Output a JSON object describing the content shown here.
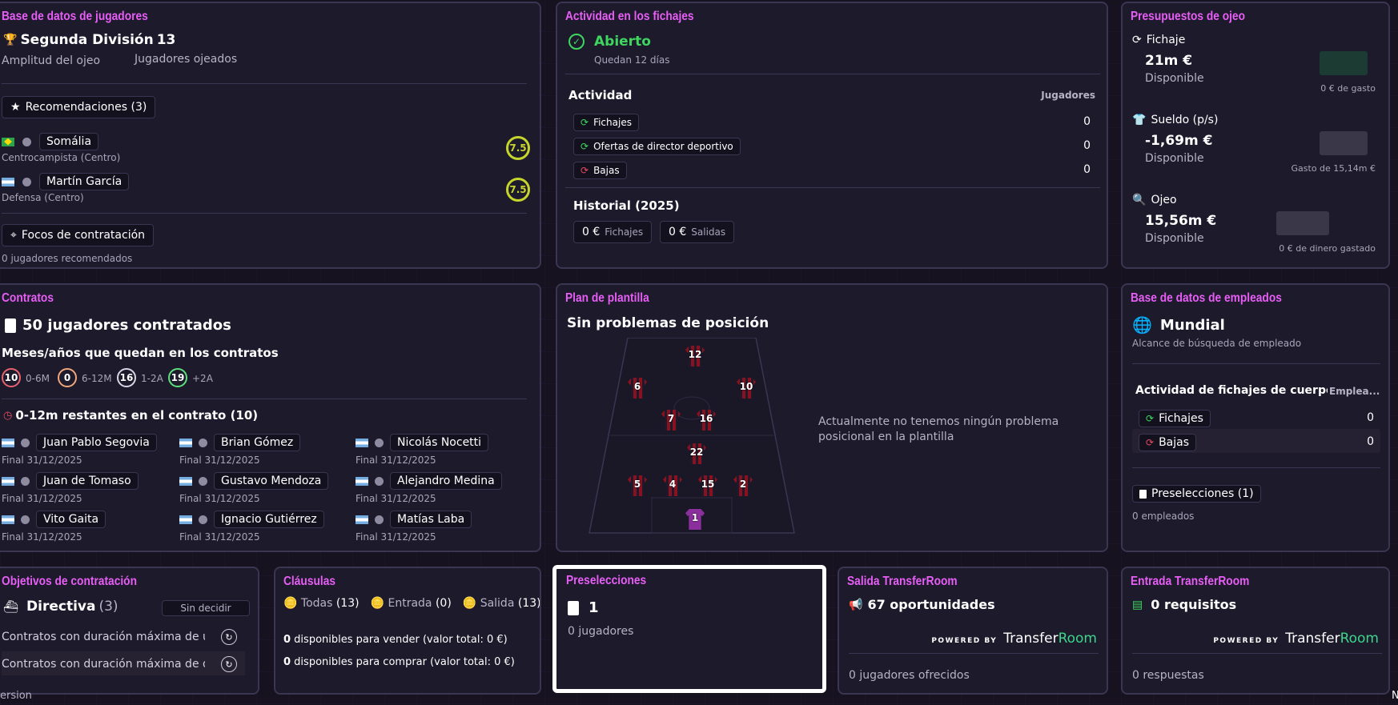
{
  "scouting": {
    "title": "Base de datos de jugadores",
    "league": "Segunda División",
    "scouted_count": "13",
    "range_label": "Amplitud del ojeo",
    "scouted_label": "Jugadores ojeados",
    "recommendations_button": "Recomendaciones (3)",
    "players": [
      {
        "name": "Somália",
        "position": "Centrocampista (Centro)",
        "rating": "7.5",
        "flag": "br"
      },
      {
        "name": "Martín García",
        "position": "Defensa (Centro)",
        "rating": "7.5",
        "flag": "ar"
      }
    ],
    "focus_button": "Focos de contratación",
    "focus_sub": "0 jugadores recomendados"
  },
  "transfer_activity": {
    "title": "Actividad en los fichajes",
    "status": "Abierto",
    "days_left": "Quedan 12 días",
    "activity_label": "Actividad",
    "players_label": "Jugadores",
    "rows": [
      {
        "label": "Fichajes",
        "value": "0"
      },
      {
        "label": "Ofertas de director deportivo",
        "value": "0"
      },
      {
        "label": "Bajas",
        "value": "0"
      }
    ],
    "history_label": "Historial (2025)",
    "history": [
      {
        "amount": "0 €",
        "label": "Fichajes"
      },
      {
        "amount": "0 €",
        "label": "Salidas"
      }
    ]
  },
  "budgets": {
    "title": "Presupuestos de ojeo",
    "items": [
      {
        "label": "Fichaje",
        "amount": "21m €",
        "status": "Disponible",
        "note": "0 € de gasto",
        "color": "#1b3b33"
      },
      {
        "label": "Sueldo (p/s)",
        "amount": "-1,69m €",
        "status": "Disponible",
        "note": "Gasto de 15,14m €",
        "color": "#3a3748"
      },
      {
        "label": "Ojeo",
        "amount": "15,56m €",
        "status": "Disponible",
        "note": "0 € de dinero gastado",
        "color": "#3a3748"
      }
    ]
  },
  "contracts": {
    "title": "Contratos",
    "count_label": "50 jugadores contratados",
    "remaining_label": "Meses/años que quedan en los contratos",
    "buckets": [
      {
        "count": "10",
        "label": "0-6M",
        "color": "#e8636e"
      },
      {
        "count": "0",
        "label": "6-12M",
        "color": "#f2a77b"
      },
      {
        "count": "16",
        "label": "1-2A",
        "color": "#d9d6e3"
      },
      {
        "count": "19",
        "label": "+2A",
        "color": "#5ee07c"
      }
    ],
    "expiring_label": "0-12m restantes en el contrato (10)",
    "expiring": [
      {
        "name": "Juan Pablo Segovia",
        "date": "Final  31/12/2025"
      },
      {
        "name": "Brian Gómez",
        "date": "Final  31/12/2025"
      },
      {
        "name": "Nicolás Nocetti",
        "date": "Final  31/12/2025"
      },
      {
        "name": "Juan de Tomaso",
        "date": "Final  31/12/2025"
      },
      {
        "name": "Gustavo Mendoza",
        "date": "Final  31/12/2025"
      },
      {
        "name": "Alejandro Medina",
        "date": "Final  31/12/2025"
      },
      {
        "name": "Vito Gaita",
        "date": "Final  31/12/2025"
      },
      {
        "name": "Ignacio Gutiérrez",
        "date": "Final  31/12/2025"
      },
      {
        "name": "Matías Laba",
        "date": "Final  31/12/2025"
      }
    ]
  },
  "squad_plan": {
    "title": "Plan de plantilla",
    "status": "Sin problemas de posición",
    "message": "Actualmente no tenemos ningún problema posicional en la plantilla",
    "numbers": [
      "12",
      "6",
      "10",
      "7",
      "16",
      "22",
      "5",
      "4",
      "15",
      "2",
      "1"
    ]
  },
  "staff_db": {
    "title": "Base de datos de empleados",
    "scope": "Mundial",
    "scope_sub": "Alcance de búsqueda de empleado",
    "activity_label": "Actividad de fichajes de cuerpo ...",
    "employees_label": "Emplea...",
    "rows": [
      {
        "label": "Fichajes",
        "value": "0"
      },
      {
        "label": "Bajas",
        "value": "0"
      }
    ],
    "shortlist_button": "Preselecciones (1)",
    "shortlist_sub": "0 empleados"
  },
  "objectives": {
    "title": "Objetivos de contratación",
    "label": "Directiva",
    "count": "(3)",
    "undecided": "Sin decidir",
    "items": [
      "Contratos con duración máxima de un...",
      "Contratos con duración máxima de do..."
    ],
    "footer": "ersion"
  },
  "clauses": {
    "title": "Cláusulas",
    "tabs": [
      {
        "label": "Todas",
        "count": "(13)"
      },
      {
        "label": "Entrada",
        "count": "(0)"
      },
      {
        "label": "Salida",
        "count": "(13)"
      }
    ],
    "sell_count": "0",
    "sell_text": " disponibles para vender (valor total: 0 €)",
    "buy_count": "0",
    "buy_text": " disponibles para comprar (valor total: 0 €)"
  },
  "shortlists": {
    "title": "Preselecciones",
    "count": "1",
    "sub": "0 jugadores"
  },
  "tr_out": {
    "title": "Salida TransferRoom",
    "count_label": "67 oportunidades",
    "powered": "POWERED BY",
    "brand_a": "Transfer",
    "brand_b": "Room",
    "sub": "0 jugadores ofrecidos"
  },
  "tr_in": {
    "title": "Entrada TransferRoom",
    "count_label": "0 requisitos",
    "powered": "POWERED BY",
    "brand_a": "Transfer",
    "brand_b": "Room",
    "sub": "0 respuestas"
  },
  "edge_text": "N"
}
